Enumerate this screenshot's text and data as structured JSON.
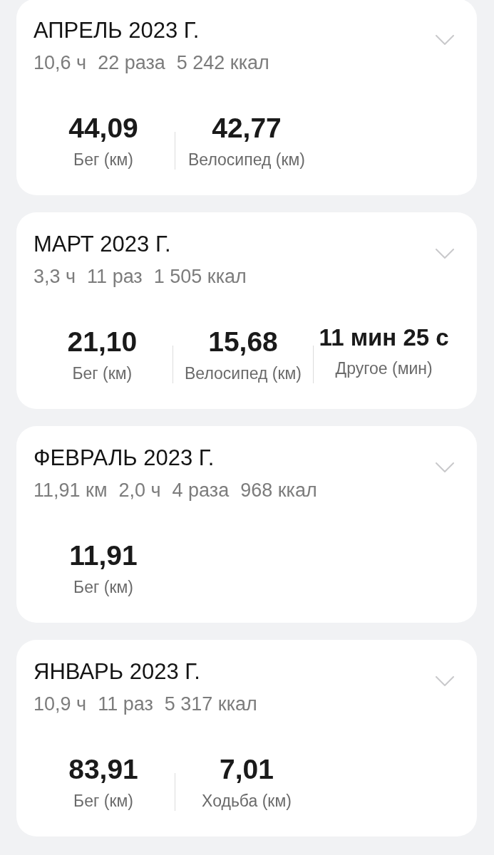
{
  "months": [
    {
      "title": "АПРЕЛЬ 2023 Г.",
      "summary": [
        "10,6 ч",
        "22 раза",
        "5 242 ккал"
      ],
      "expanded": false,
      "stats": [
        {
          "kind": "distance",
          "value": "44,09",
          "label": "Бег (км)"
        },
        {
          "kind": "distance",
          "value": "42,77",
          "label": "Велосипед (км)"
        }
      ]
    },
    {
      "title": "МАРТ 2023 Г.",
      "summary": [
        "3,3 ч",
        "11 раз",
        "1 505 ккал"
      ],
      "expanded": false,
      "stats": [
        {
          "kind": "distance",
          "value": "21,10",
          "label": "Бег (км)"
        },
        {
          "kind": "distance",
          "value": "15,68",
          "label": "Велосипед (км)"
        },
        {
          "kind": "duration",
          "value": "11 мин 25 с",
          "label": "Другое (мин)"
        }
      ]
    },
    {
      "title": "ФЕВРАЛЬ 2023 Г.",
      "summary": [
        "11,91 км",
        "2,0 ч",
        "4 раза",
        "968 ккал"
      ],
      "expanded": false,
      "stats": [
        {
          "kind": "distance",
          "value": "11,91",
          "label": "Бег (км)"
        }
      ]
    },
    {
      "title": "ЯНВАРЬ 2023 Г.",
      "summary": [
        "10,9 ч",
        "11 раз",
        "5 317 ккал"
      ],
      "expanded": false,
      "stats": [
        {
          "kind": "distance",
          "value": "83,91",
          "label": "Бег (км)"
        },
        {
          "kind": "distance",
          "value": "7,01",
          "label": "Ходьба (км)"
        }
      ]
    }
  ]
}
